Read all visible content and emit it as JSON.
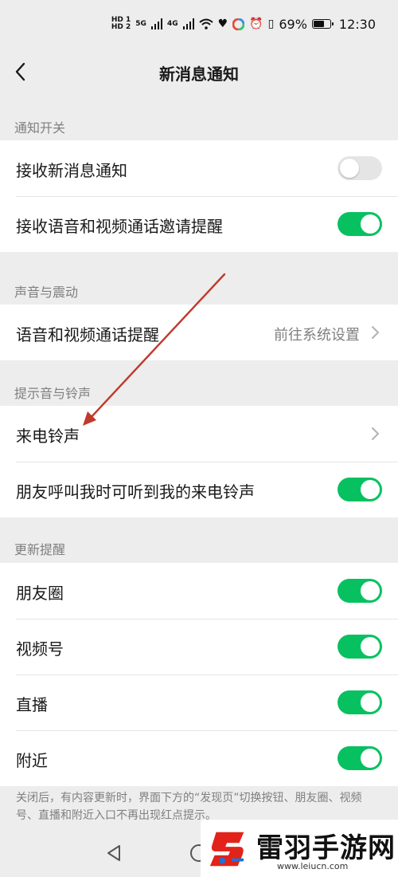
{
  "status": {
    "hd_top": "HD 1",
    "hd_bottom": "HD 2",
    "sig1": "5G",
    "sig2": "4G",
    "battery_percent": "69%",
    "battery_level": 0.69,
    "time": "12:30"
  },
  "nav": {
    "title": "新消息通知"
  },
  "sections": {
    "notify_switch": {
      "header": "通知开关",
      "rows": [
        {
          "label": "接收新消息通知",
          "toggle": "off"
        },
        {
          "label": "接收语音和视频通话邀请提醒",
          "toggle": "on"
        }
      ]
    },
    "sound_vibration": {
      "header": "声音与震动",
      "rows": [
        {
          "label": "语音和视频通话提醒",
          "value": "前往系统设置"
        }
      ]
    },
    "tones": {
      "header": "提示音与铃声",
      "rows": [
        {
          "label": "来电铃声"
        },
        {
          "label": "朋友呼叫我时可听到我的来电铃声",
          "toggle": "on"
        }
      ]
    },
    "updates": {
      "header": "更新提醒",
      "rows": [
        {
          "label": "朋友圈",
          "toggle": "on"
        },
        {
          "label": "视频号",
          "toggle": "on"
        },
        {
          "label": "直播",
          "toggle": "on"
        },
        {
          "label": "附近",
          "toggle": "on"
        }
      ]
    }
  },
  "footnote": "关闭后，有内容更新时，界面下方的“发现页”切换按钮、朋友圈、视频号、直播和附近入口不再出现红点提示。",
  "watermark": {
    "title": "雷羽手游网",
    "url": "www.leiucn.com"
  },
  "colors": {
    "accent": "#07c160",
    "background": "#ededed",
    "annotation_arrow": "#c0392b",
    "logo_red": "#e2231a"
  }
}
